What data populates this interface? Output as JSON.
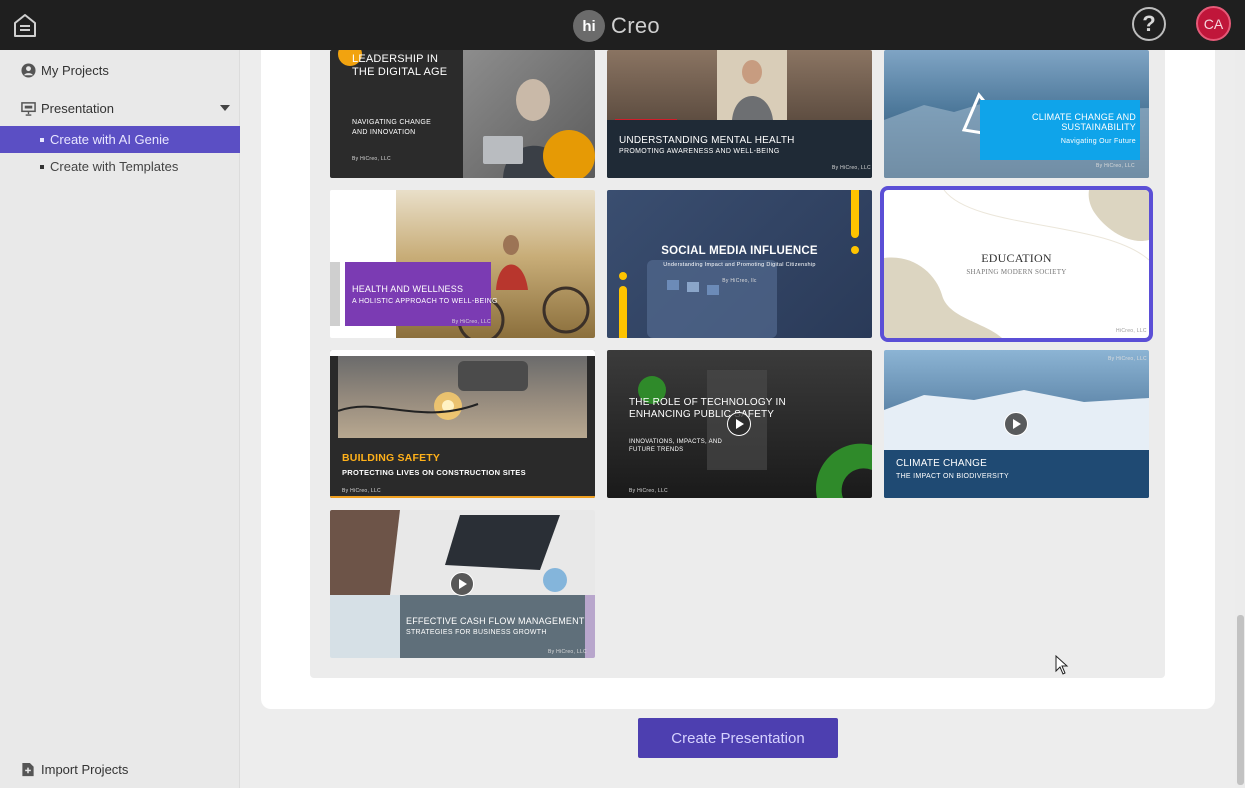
{
  "header": {
    "logo_badge": "hi",
    "logo_text": "Creo",
    "help_label": "?",
    "avatar_initials": "CA"
  },
  "sidebar": {
    "my_projects": "My Projects",
    "presentation": "Presentation",
    "create_ai_genie": "Create with AI Genie",
    "create_templates": "Create with Templates",
    "import_projects": "Import Projects"
  },
  "templates": [
    {
      "title": "Leadership in the Digital Age",
      "subtitle": "Navigating Change and Innovation",
      "by": "By HiCreo, LLC"
    },
    {
      "title": "Understanding Mental Health",
      "subtitle": "Promoting Awareness and Well-Being",
      "by": "By HiCreo, LLC"
    },
    {
      "title": "Climate Change and Sustainability",
      "subtitle": "Navigating Our Future",
      "by": "By HiCreo, LLC"
    },
    {
      "title": "Health and Wellness",
      "subtitle": "A Holistic Approach to Well-Being",
      "by": "By HiCreo, LLC"
    },
    {
      "title": "Social Media Influence",
      "subtitle": "Understanding Impact and Promoting Digital Citizenship",
      "by": "By HiCreo, llc"
    },
    {
      "title": "Education",
      "subtitle": "Shaping Modern Society",
      "by": "HiCreo, LLC"
    },
    {
      "title": "Building Safety",
      "subtitle": "Protecting Lives on Construction Sites",
      "by": "By HiCreo, LLC"
    },
    {
      "title": "The Role of Technology in Enhancing Public Safety",
      "subtitle": "Innovations, Impacts, and Future Trends",
      "by": "By HiCreo, LLC"
    },
    {
      "title": "Climate Change",
      "subtitle": "The Impact on Biodiversity",
      "by": "By HiCreo, LLC"
    },
    {
      "title": "Effective Cash Flow Management",
      "subtitle": "Strategies for Business Growth",
      "by": "By HiCreo, LLC"
    }
  ],
  "actions": {
    "create_presentation": "Create Presentation"
  },
  "colors": {
    "accent": "#5b4fc4",
    "topbar": "#1f1f1f",
    "avatar": "#c0163a"
  }
}
